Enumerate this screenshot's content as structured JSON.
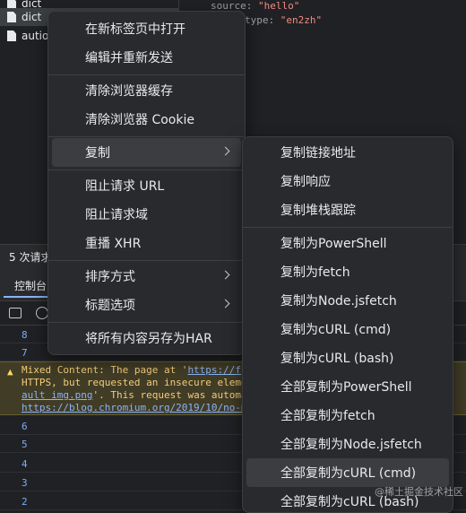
{
  "request_list": {
    "items": [
      "dict",
      "dict",
      "autio"
    ]
  },
  "preview": {
    "line1_key": "source:",
    "line1_val": "\"hello\"",
    "line2_key": "type:",
    "line2_val": "\"en2zh\""
  },
  "status_bar": {
    "text": "5 次请求"
  },
  "console_tab": {
    "label": "控制台"
  },
  "console": {
    "lines_top": [
      "8",
      "7"
    ],
    "warning": {
      "prefix": "Mixed Content: The page at '",
      "link1": "https://f",
      "line2": "HTTPS, but requested an insecure eleme",
      "line3_link": "ault img.png",
      "line3_text": "'. This request was automa",
      "line4_link": "https://blog.chromium.org/2019/10/no-m"
    },
    "lines_bottom": [
      "6",
      "5",
      "4",
      "3",
      "2"
    ]
  },
  "context_menu": {
    "items": [
      "在新标签页中打开",
      "编辑并重新发送",
      "清除浏览器缓存",
      "清除浏览器 Cookie",
      "复制",
      "阻止请求 URL",
      "阻止请求域",
      "重播 XHR",
      "排序方式",
      "标题选项",
      "将所有内容另存为HAR"
    ]
  },
  "copy_submenu": {
    "items": [
      "复制链接地址",
      "复制响应",
      "复制堆栈跟踪",
      "复制为PowerShell",
      "复制为fetch",
      "复制为Node.jsfetch",
      "复制为cURL (cmd)",
      "复制为cURL (bash)",
      "全部复制为PowerShell",
      "全部复制为fetch",
      "全部复制为Node.jsfetch",
      "全部复制为cURL (cmd)",
      "全部复制为cURL (bash)"
    ]
  },
  "watermark": "@稀土掘金技术社区",
  "colors": {
    "menu_bg": "#292a2d",
    "highlight": "#3c3d41",
    "warning_bg": "#413c26",
    "link": "#8ab4f8"
  }
}
